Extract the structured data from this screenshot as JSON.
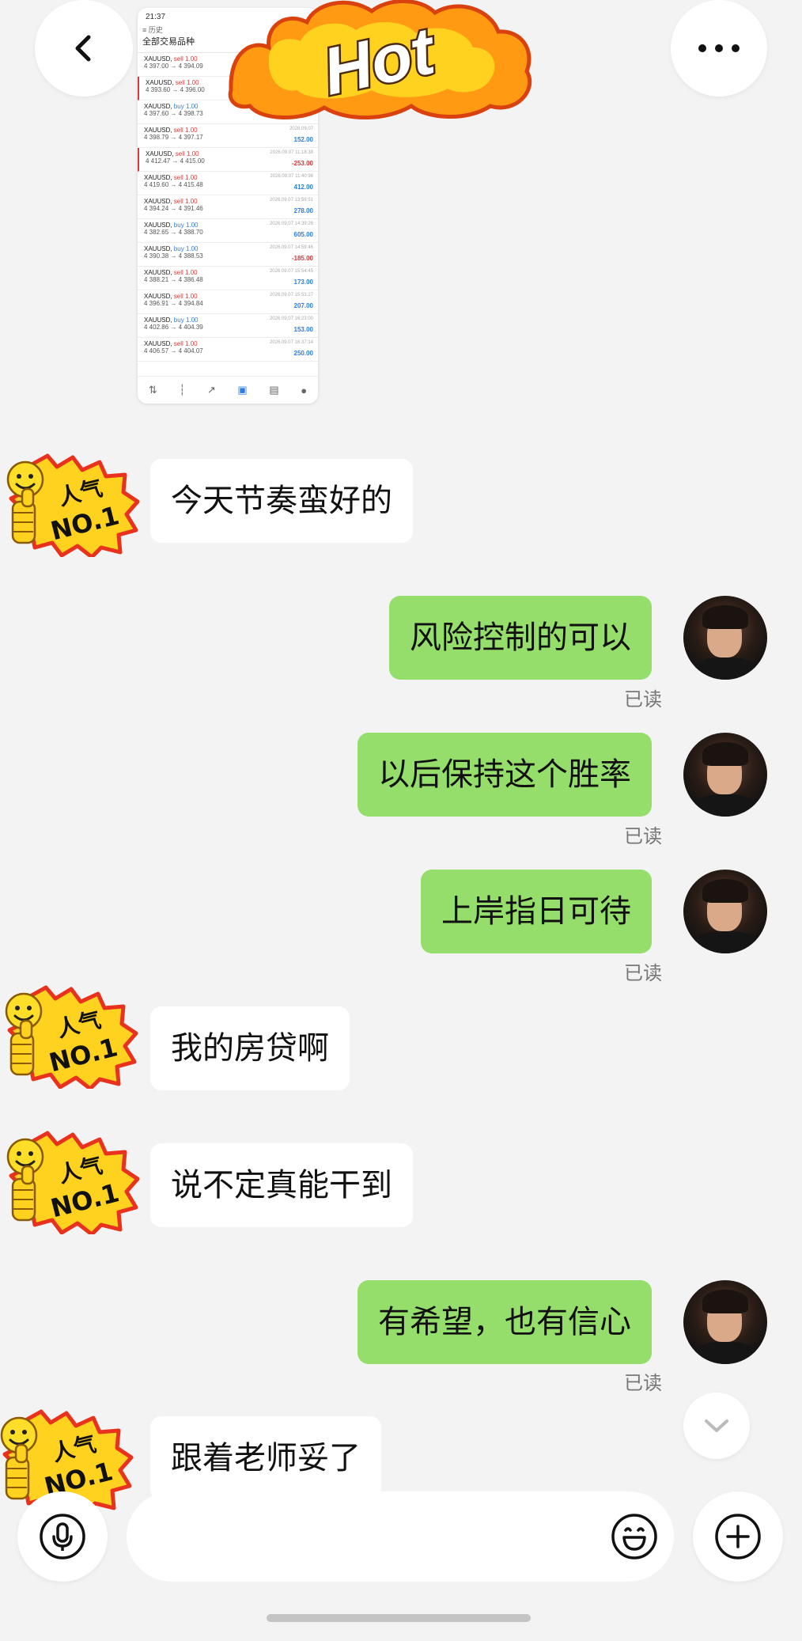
{
  "header": {
    "back_icon": "chevron-left-icon",
    "more_icon": "more-horizontal-icon"
  },
  "screenshot": {
    "status_time": "21:37",
    "header_label": "历史",
    "subheader_label": "全部交易品种",
    "trades": [
      {
        "symbol": "XAUUSD",
        "side": "sell",
        "lots": "1.00",
        "from": "4 397.00",
        "to": "4 394.09",
        "time": "",
        "pnl": "",
        "marked": false
      },
      {
        "symbol": "XAUUSD",
        "side": "sell",
        "lots": "1.00",
        "from": "4 393.60",
        "to": "4 396.00",
        "time": "",
        "pnl": "",
        "marked": true
      },
      {
        "symbol": "XAUUSD",
        "side": "buy",
        "lots": "1.00",
        "from": "4 397.60",
        "to": "4 398.73",
        "time": "",
        "pnl": "",
        "marked": false
      },
      {
        "symbol": "XAUUSD",
        "side": "sell",
        "lots": "1.00",
        "from": "4 398.79",
        "to": "4 397.17",
        "time": "2026.09.07",
        "pnl": "152.00",
        "marked": false
      },
      {
        "symbol": "XAUUSD",
        "side": "sell",
        "lots": "1.00",
        "from": "4 412.47",
        "to": "4 415.00",
        "time": "2026.09.07 11:18:38",
        "pnl": "-253.00",
        "marked": true
      },
      {
        "symbol": "XAUUSD",
        "side": "sell",
        "lots": "1.00",
        "from": "4 419.60",
        "to": "4 415.48",
        "time": "2026.09.07 11:40:98",
        "pnl": "412.00",
        "marked": false
      },
      {
        "symbol": "XAUUSD",
        "side": "sell",
        "lots": "1.00",
        "from": "4 394.24",
        "to": "4 391.46",
        "time": "2026.09.07 13:59:51",
        "pnl": "278.00",
        "marked": false
      },
      {
        "symbol": "XAUUSD",
        "side": "buy",
        "lots": "1.00",
        "from": "4 382.65",
        "to": "4 388.70",
        "time": "2026.09.07 14:39:26",
        "pnl": "605.00",
        "marked": false
      },
      {
        "symbol": "XAUUSD",
        "side": "buy",
        "lots": "1.00",
        "from": "4 390.38",
        "to": "4 388.53",
        "time": "2026.09.07 14:59:46",
        "pnl": "-185.00",
        "marked": false
      },
      {
        "symbol": "XAUUSD",
        "side": "sell",
        "lots": "1.00",
        "from": "4 388.21",
        "to": "4 386.48",
        "time": "2026.09.07 15:54:45",
        "pnl": "173.00",
        "marked": false
      },
      {
        "symbol": "XAUUSD",
        "side": "sell",
        "lots": "1.00",
        "from": "4 396.91",
        "to": "4 394.84",
        "time": "2026.09.07 15:53:27",
        "pnl": "207.00",
        "marked": false
      },
      {
        "symbol": "XAUUSD",
        "side": "buy",
        "lots": "1.00",
        "from": "4 402.86",
        "to": "4 404.39",
        "time": "2026.09.07 16:23:00",
        "pnl": "153.00",
        "marked": false
      },
      {
        "symbol": "XAUUSD",
        "side": "sell",
        "lots": "1.00",
        "from": "4 406.57",
        "to": "4 404.07",
        "time": "2026.09.07 16:37:14",
        "pnl": "250.00",
        "marked": false
      }
    ]
  },
  "sticker": {
    "hot_text": "Hot"
  },
  "badge": {
    "line1": "人气",
    "line2": "NO.1"
  },
  "messages": {
    "m1": "今天节奏蛮好的",
    "m2": "风险控制的可以",
    "m3": "以后保持这个胜率",
    "m4": "上岸指日可待",
    "m5": "我的房贷啊",
    "m6": "说不定真能干到",
    "m7": "有希望，也有信心",
    "m8": "跟着老师妥了"
  },
  "read_label": "已读",
  "input_bar": {
    "voice_icon": "microphone-icon",
    "emoji_icon": "emoji-icon",
    "plus_icon": "plus-icon"
  },
  "colors": {
    "background": "#f3f3f3",
    "outgoing_bubble": "#95de6c",
    "incoming_bubble": "#ffffff",
    "sell": "#d23b3b",
    "buy": "#2d7ee0"
  }
}
